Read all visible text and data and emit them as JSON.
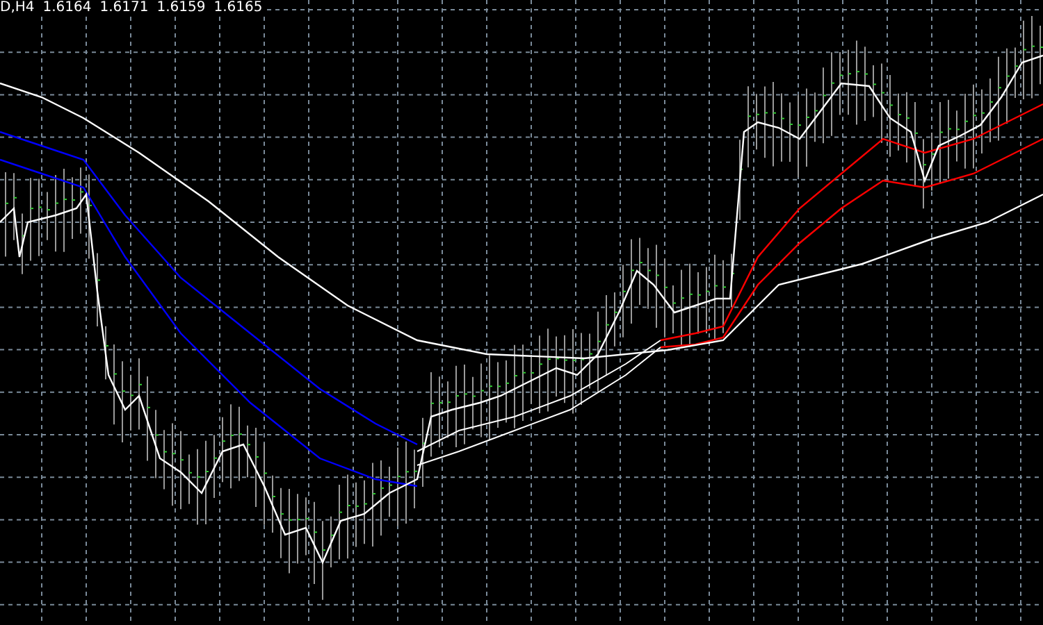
{
  "chart_header": {
    "symbol": "D,H4",
    "prices": [
      "1.6164",
      "1.6171",
      "1.6159",
      "1.6165"
    ]
  }
}
